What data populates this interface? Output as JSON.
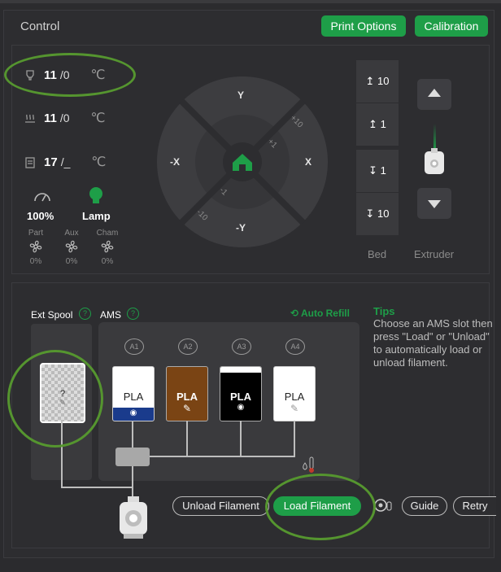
{
  "header": {
    "title": "Control",
    "print_options": "Print Options",
    "calibration": "Calibration"
  },
  "temps": {
    "nozzle": {
      "current": "11",
      "target": "/0",
      "unit": "℃"
    },
    "bed": {
      "current": "11",
      "target": "/0",
      "unit": "℃"
    },
    "chamber": {
      "current": "17",
      "target": "/_",
      "unit": "℃"
    }
  },
  "speed": {
    "value": "100%"
  },
  "lamp": {
    "label": "Lamp"
  },
  "fans": [
    {
      "label": "Part",
      "pct": "0%"
    },
    {
      "label": "Aux",
      "pct": "0%"
    },
    {
      "label": "Cham",
      "pct": "0%"
    }
  ],
  "jog": {
    "y": "Y",
    "neg_y": "-Y",
    "x": "X",
    "neg_x": "-X",
    "p10": "+10",
    "p1": "+1",
    "m1": "-1",
    "m10": "-10"
  },
  "bed_z": {
    "up10": "10",
    "up1": "1",
    "down1": "1",
    "down10": "10",
    "label": "Bed"
  },
  "extruder": {
    "label": "Extruder"
  },
  "ams": {
    "ext_spool_label": "Ext Spool",
    "ams_label": "AMS",
    "help": "?",
    "auto_refill": "Auto Refill",
    "ext_unknown": "?",
    "slots": [
      {
        "id": "A1",
        "material": "PLA",
        "color": "#1a3b8c"
      },
      {
        "id": "A2",
        "material": "PLA",
        "color": "#7a4414"
      },
      {
        "id": "A3",
        "material": "PLA",
        "color": "#000000"
      },
      {
        "id": "A4",
        "material": "PLA",
        "color": "#ffffff"
      }
    ]
  },
  "tips": {
    "title": "Tips",
    "lines": [
      "Choose an AMS slot then",
      "press \"Load\" or \"Unload\"",
      "to automatically load or",
      "unload filament."
    ]
  },
  "actions": {
    "unload": "Unload Filament",
    "load": "Load Filament",
    "guide": "Guide",
    "retry": "Retry"
  },
  "colors": {
    "accent": "#1e9e48",
    "highlight_ring": "#55952f"
  }
}
